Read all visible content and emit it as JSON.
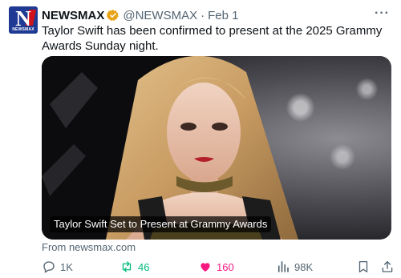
{
  "author": {
    "name": "NEWSMAX",
    "handle": "@NEWSMAX",
    "separator": "·",
    "date": "Feb 1",
    "avatar_letter": "N",
    "avatar_word": "NEWSMAX",
    "verified_color": "#e8a317"
  },
  "post": {
    "text": "Taylor Swift has been confirmed to present at the 2025 Grammy Awards Sunday night."
  },
  "card": {
    "caption": "Taylor Swift Set to Present at Grammy Awards",
    "source": "From newsmax.com"
  },
  "actions": {
    "replies": "1K",
    "reposts": "46",
    "likes": "160",
    "views": "98K"
  },
  "colors": {
    "brand_blue": "#1f3a93",
    "brand_red": "#d0121b",
    "like": "#f91880",
    "repost": "#00ba7c",
    "muted": "#536471"
  },
  "icons": [
    "more-icon",
    "verified-badge-icon",
    "reply-icon",
    "repost-icon",
    "like-icon",
    "views-icon",
    "bookmark-icon",
    "share-icon"
  ]
}
